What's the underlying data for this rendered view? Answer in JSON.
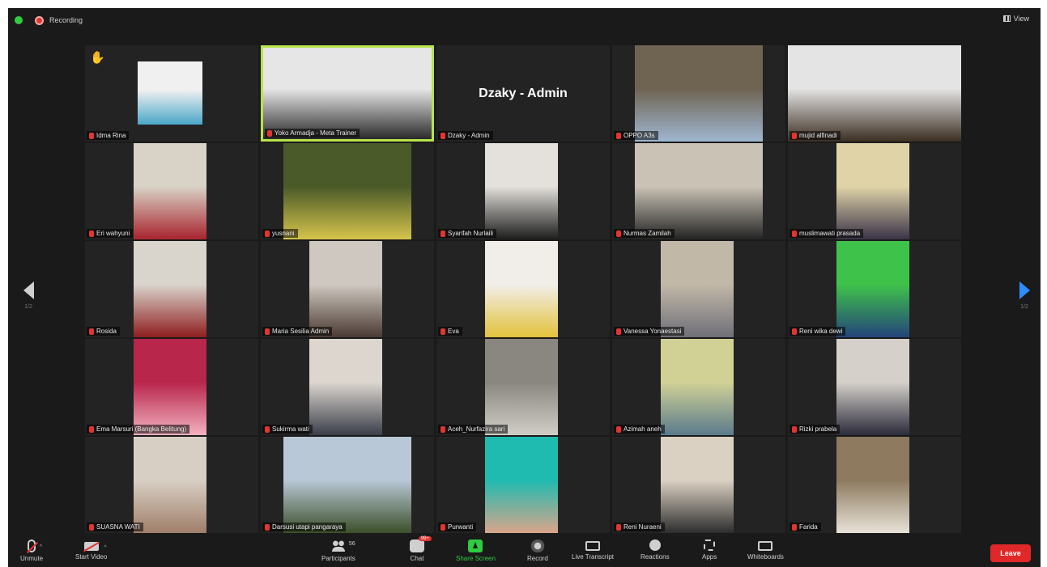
{
  "topbar": {
    "recording": "Recording",
    "view": "View"
  },
  "pager": {
    "left": "1/2",
    "right": "1/2"
  },
  "tiles": [
    {
      "name": "Idma Rina",
      "bg": "#f0f0f0",
      "kind": "avatar",
      "accent": "#4aa7c9",
      "raised_hand": true
    },
    {
      "name": "Yoko Armadja - Meta Trainer",
      "bg": "#e6e6e6",
      "kind": "full",
      "accent": "#2a2a2a",
      "active": true
    },
    {
      "name": "Dzaky - Admin",
      "bg": "",
      "kind": "name_only"
    },
    {
      "name": "OPPO A3s",
      "bg": "#6f6452",
      "kind": "mid",
      "accent": "#9fb6d1"
    },
    {
      "name": "mujid alfinadi",
      "bg": "#e4e4e4",
      "kind": "full",
      "accent": "#3b2e22"
    },
    {
      "name": "Eri wahyuni",
      "bg": "#d9d2c6",
      "kind": "narrow",
      "accent": "#a8242e"
    },
    {
      "name": "yusnani",
      "bg": "#4a5a28",
      "kind": "mid",
      "accent": "#d6c44c"
    },
    {
      "name": "Syarifah Nurlaili",
      "bg": "#e4e1dc",
      "kind": "narrow",
      "accent": "#1c1c1c"
    },
    {
      "name": "Nurmas Zamilah",
      "bg": "#c9c2b5",
      "kind": "mid",
      "accent": "#242424"
    },
    {
      "name": "muslimawati prasada",
      "bg": "#dfd3a7",
      "kind": "narrow",
      "accent": "#3a3348"
    },
    {
      "name": "Rosida",
      "bg": "#d9d4cc",
      "kind": "narrow",
      "accent": "#8e1e1e"
    },
    {
      "name": "Maria Sesilia Admin",
      "bg": "#cfc8c0",
      "kind": "narrow",
      "accent": "#4a3a33"
    },
    {
      "name": "Eva",
      "bg": "#f1eee9",
      "kind": "narrow",
      "accent": "#e3c23b"
    },
    {
      "name": "Vanessa Yonaestasi",
      "bg": "#c2b8a8",
      "kind": "narrow",
      "accent": "#6f6f78"
    },
    {
      "name": "Reni wika dewi",
      "bg": "#3fc24a",
      "kind": "narrow",
      "accent": "#24447a"
    },
    {
      "name": "Ema Marsuri (Bangka Belitung)",
      "bg": "#b8264c",
      "kind": "narrow",
      "accent": "#f3b1c0"
    },
    {
      "name": "Sukirma wati",
      "bg": "#dcd6cf",
      "kind": "narrow",
      "accent": "#3b3f4a"
    },
    {
      "name": "Aceh_Nurfazira sari",
      "bg": "#8a8680",
      "kind": "narrow",
      "accent": "#d1cdc7"
    },
    {
      "name": "Azimah aneh",
      "bg": "#d1d196",
      "kind": "narrow",
      "accent": "#5a7b8c"
    },
    {
      "name": "Rizki prabela",
      "bg": "#d5d0ca",
      "kind": "narrow",
      "accent": "#2b2b3a"
    },
    {
      "name": "SUASNA WATI",
      "bg": "#d8cfc4",
      "kind": "narrow",
      "accent": "#a07e6a"
    },
    {
      "name": "Darsusi utapi pangaraya",
      "bg": "#b8c8d6",
      "kind": "mid",
      "accent": "#3c4f2a"
    },
    {
      "name": "Purwanti",
      "bg": "#1fbab0",
      "kind": "narrow",
      "accent": "#d9a58a"
    },
    {
      "name": "Reni Nuraeni",
      "bg": "#dbd1c3",
      "kind": "narrow",
      "accent": "#2d2d2d"
    },
    {
      "name": "Farida",
      "bg": "#8d7a5f",
      "kind": "narrow",
      "accent": "#e8e2d8"
    }
  ],
  "toolbar": {
    "unmute": "Unmute",
    "start_video": "Start Video",
    "participants": "Participants",
    "participants_count": "56",
    "chat": "Chat",
    "chat_badge": "99+",
    "share_screen": "Share Screen",
    "record": "Record",
    "live_transcript": "Live Transcript",
    "reactions": "Reactions",
    "apps": "Apps",
    "whiteboards": "Whiteboards",
    "leave": "Leave"
  }
}
